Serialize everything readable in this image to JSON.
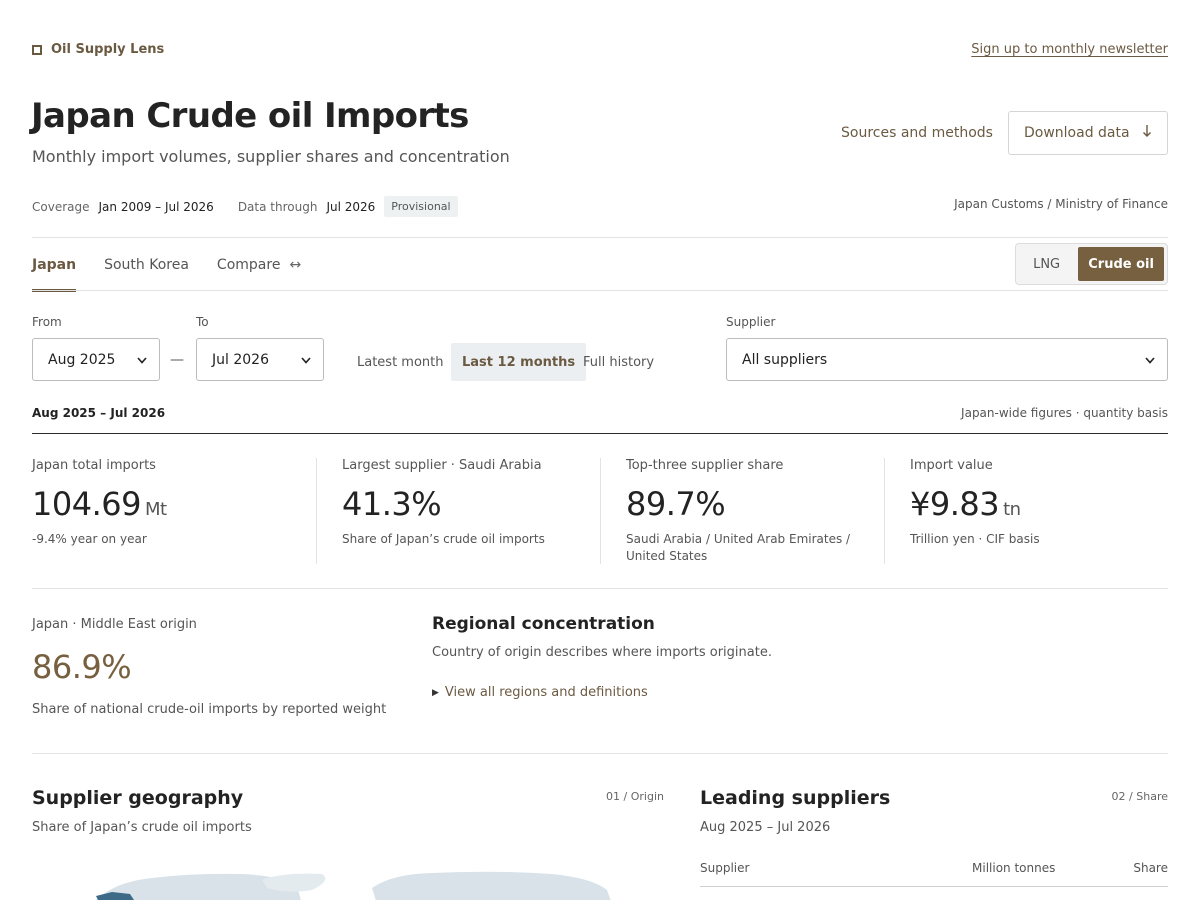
{
  "brand": {
    "name": "Oil Supply Lens",
    "icon": "square-outline-icon"
  },
  "header": {
    "newsletter_link": "Sign up to monthly newsletter",
    "title": "Japan Crude oil Imports",
    "subtitle": "Monthly import volumes, supplier shares and concentration",
    "sources_link": "Sources and methods",
    "download_label": "Download data",
    "download_icon": "arrow-down-icon"
  },
  "meta": {
    "coverage_label": "Coverage",
    "coverage_value": "Jan 2009 – Jul 2026",
    "through_label": "Data through",
    "through_value": "Jul 2026",
    "status_badge": "Provisional",
    "source": "Japan Customs / Ministry of Finance"
  },
  "tabs": [
    {
      "label": "Japan",
      "active": true
    },
    {
      "label": "South Korea",
      "active": false
    },
    {
      "label": "Compare",
      "active": false,
      "icon": "left-right-arrow-icon"
    }
  ],
  "commodity_toggle": {
    "options": [
      "LNG",
      "Crude oil"
    ],
    "selected": "Crude oil"
  },
  "filters": {
    "from_label": "From",
    "from_value": "Aug 2025",
    "to_label": "To",
    "to_value": "Jul 2026",
    "separator": "—",
    "quick_ranges": [
      "Latest month",
      "Last 12 months",
      "Full history"
    ],
    "quick_selected": "Last 12 months",
    "supplier_label": "Supplier",
    "supplier_value": "All suppliers"
  },
  "period_bar": {
    "period": "Aug 2025 – Jul 2026",
    "basis": "Japan-wide figures · quantity basis"
  },
  "kpis": [
    {
      "label": "Japan total imports",
      "value": "104.69",
      "unit": "Mt",
      "note": "-9.4% year on year"
    },
    {
      "label": "Largest supplier · Saudi Arabia",
      "value": "41.3%",
      "unit": "",
      "note": "Share of Japan’s crude oil imports"
    },
    {
      "label": "Top-three supplier share",
      "value": "89.7%",
      "unit": "",
      "note": "Saudi Arabia / United Arab Emirates / United States"
    },
    {
      "label": "Import value",
      "value": "¥9.83",
      "unit": "tn",
      "note": "Trillion yen · CIF basis"
    }
  ],
  "middle_east": {
    "label": "Japan · Middle East origin",
    "value": "86.9%",
    "note": "Share of national crude-oil imports by reported weight",
    "accent_color": "#77603f"
  },
  "regional": {
    "title": "Regional concentration",
    "description": "Country of origin describes where imports originate.",
    "details_link": "View all regions and definitions"
  },
  "geography": {
    "title": "Supplier geography",
    "subtitle": "Share of Japan’s crude oil imports",
    "number": "01 / Origin"
  },
  "leading": {
    "title": "Leading suppliers",
    "period": "Aug 2025 – Jul 2026",
    "number": "02 / Share",
    "columns": [
      "Supplier",
      "Million tonnes",
      "Share"
    ]
  },
  "colors": {
    "accent": "#6b5a42",
    "accent_fill": "#77603f",
    "map_land": "#d8e2e8",
    "map_highlight": "#3d6a87"
  }
}
